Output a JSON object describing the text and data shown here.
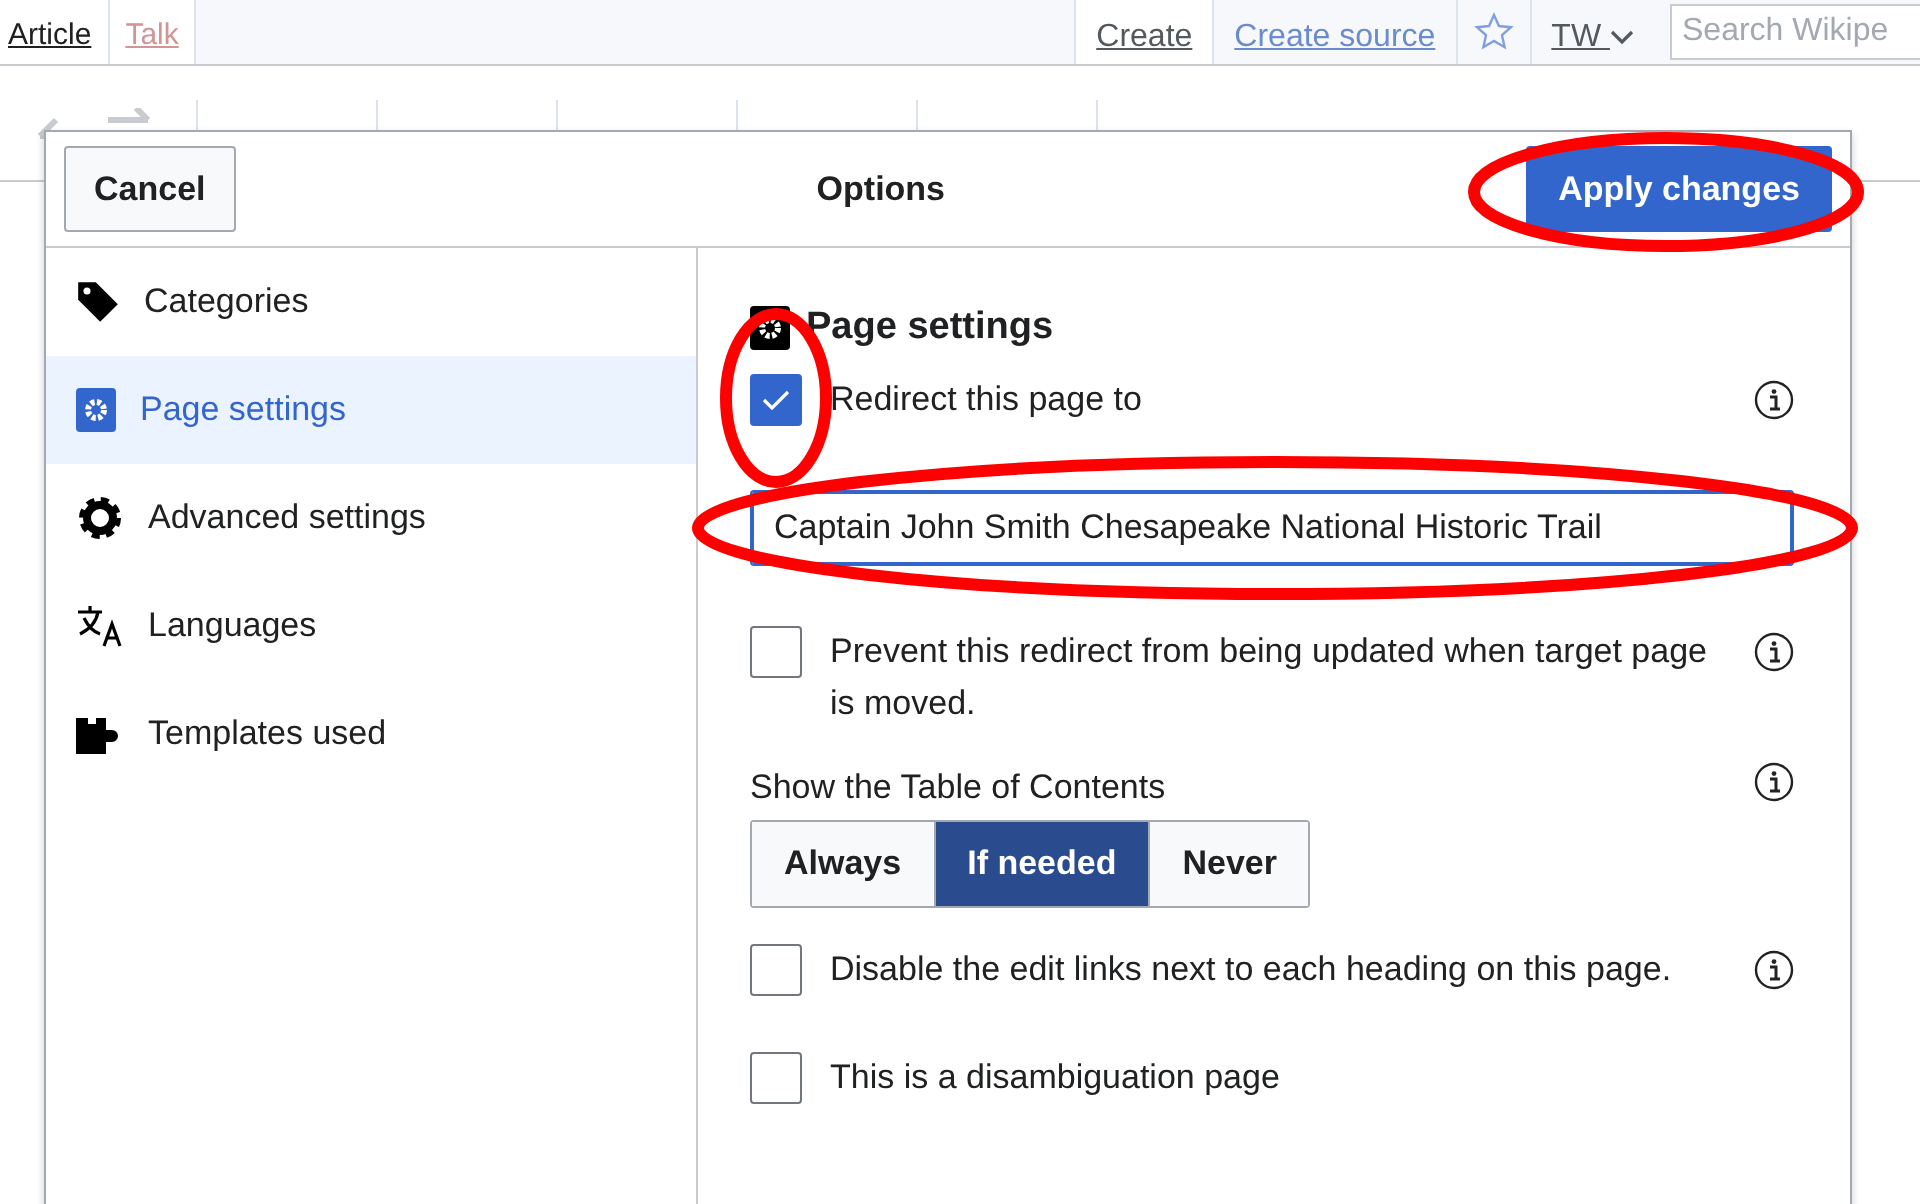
{
  "page_tabs": [
    {
      "label": "Article",
      "selected": true
    },
    {
      "label": "Talk",
      "selected": false
    }
  ],
  "actions": [
    {
      "label": "Create",
      "selected": true
    },
    {
      "label": "Create source",
      "selected": false
    }
  ],
  "user_menu": {
    "label": "TW"
  },
  "search": {
    "placeholder": "Search Wikipe"
  },
  "dialog": {
    "title": "Options",
    "cancel": "Cancel",
    "apply": {
      "label": "Apply changes",
      "circled": true
    },
    "sidebar": [
      {
        "label": "Categories",
        "selected": false
      },
      {
        "label": "Page settings",
        "selected": true
      },
      {
        "label": "Advanced settings",
        "selected": false
      },
      {
        "label": "Languages",
        "selected": false
      },
      {
        "label": "Templates used",
        "selected": false
      }
    ],
    "section_title": "Page settings",
    "fields": [
      {
        "kind": "checkbox",
        "label": "Redirect this page to",
        "checked": true,
        "info": true,
        "circled": true
      },
      {
        "kind": "text",
        "value": "Captain John Smith Chesapeake National Historic Trail",
        "circled": true
      },
      {
        "kind": "checkbox",
        "label": "Prevent this redirect from being updated when target page is moved.",
        "checked": false,
        "info": true,
        "circled": false
      },
      {
        "kind": "segmented",
        "label": "Show the Table of Contents",
        "info": true,
        "options": [
          {
            "label": "Always",
            "selected": false
          },
          {
            "label": "If needed",
            "selected": true
          },
          {
            "label": "Never",
            "selected": false
          }
        ]
      },
      {
        "kind": "checkbox",
        "label": "Disable the edit links next to each heading on this page.",
        "checked": false,
        "info": true,
        "circled": false
      },
      {
        "kind": "checkbox",
        "label": "This is a disambiguation page",
        "checked": false,
        "info": false,
        "circled": false
      }
    ]
  }
}
